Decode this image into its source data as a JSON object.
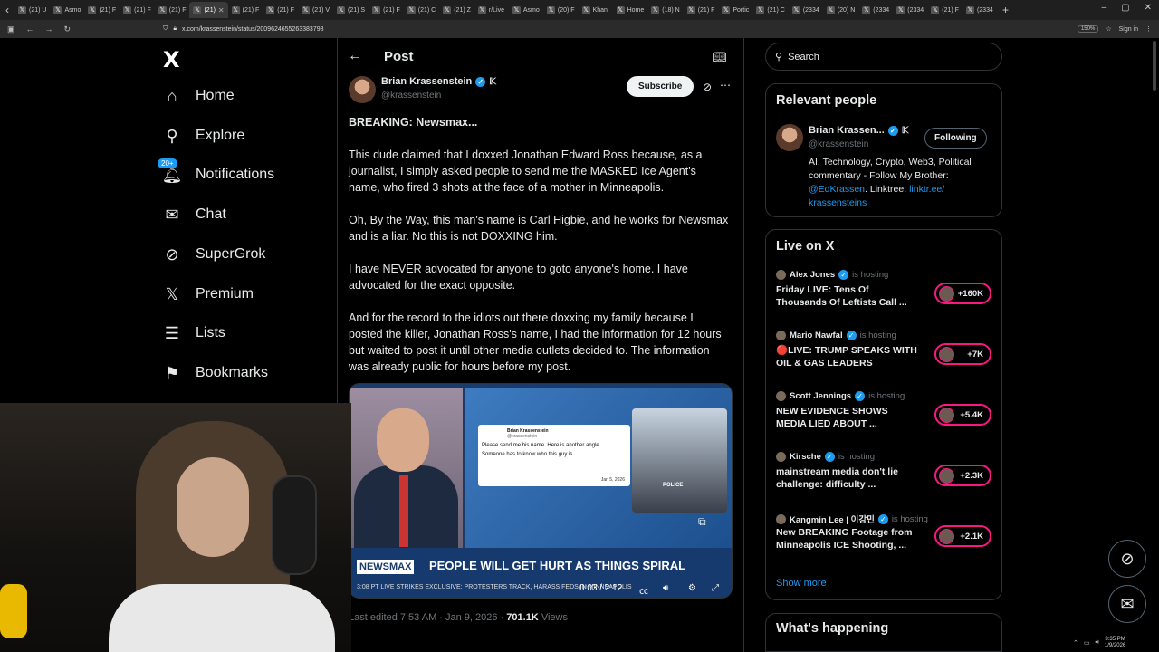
{
  "browser": {
    "tabs": [
      {
        "label": "(21) U",
        "active": false
      },
      {
        "label": "Asmo",
        "active": false
      },
      {
        "label": "(21) F",
        "active": false
      },
      {
        "label": "(21) F",
        "active": false
      },
      {
        "label": "(21) F",
        "active": false
      },
      {
        "label": "(21)",
        "active": true
      },
      {
        "label": "(21) F",
        "active": false
      },
      {
        "label": "(21) F",
        "active": false
      },
      {
        "label": "(21) V",
        "active": false
      },
      {
        "label": "(21) S",
        "active": false
      },
      {
        "label": "(21) F",
        "active": false
      },
      {
        "label": "(21) C",
        "active": false
      },
      {
        "label": "(21) Z",
        "active": false
      },
      {
        "label": "r/Live",
        "active": false
      },
      {
        "label": "Asmo",
        "active": false
      },
      {
        "label": "(20) F",
        "active": false
      },
      {
        "label": "Khan",
        "active": false
      },
      {
        "label": "Home",
        "active": false
      },
      {
        "label": "(18) N",
        "active": false
      },
      {
        "label": "(21) F",
        "active": false
      },
      {
        "label": "Portic",
        "active": false
      },
      {
        "label": "(21) C",
        "active": false
      },
      {
        "label": "(2334",
        "active": false
      },
      {
        "label": "(20) N",
        "active": false
      },
      {
        "label": "(2334",
        "active": false
      },
      {
        "label": "(2334",
        "active": false
      },
      {
        "label": "(21) F",
        "active": false
      },
      {
        "label": "(2334",
        "active": false
      }
    ],
    "url": "x.com/krassenstein/status/2009624655263383798",
    "zoom": "150%",
    "sign_in": "Sign in"
  },
  "nav": {
    "logo": "X",
    "items": [
      {
        "label": "Home",
        "icon": "home-icon",
        "glyph": "⌂"
      },
      {
        "label": "Explore",
        "icon": "search-icon",
        "glyph": "⚲"
      },
      {
        "label": "Notifications",
        "icon": "bell-icon",
        "glyph": "🔔︎",
        "badge": "20+"
      },
      {
        "label": "Chat",
        "icon": "mail-icon",
        "glyph": "✉"
      },
      {
        "label": "SuperGrok",
        "icon": "grok-icon",
        "glyph": "⊘"
      },
      {
        "label": "Premium",
        "icon": "x-premium-icon",
        "glyph": "𝕏"
      },
      {
        "label": "Lists",
        "icon": "lists-icon",
        "glyph": "☰"
      },
      {
        "label": "Bookmarks",
        "icon": "bookmark-icon",
        "glyph": "⚑"
      }
    ]
  },
  "post": {
    "header_title": "Post",
    "author_name": "Brian Krassenstein",
    "author_handle": "@krassenstein",
    "subscribe_label": "Subscribe",
    "paragraphs": [
      "BREAKING:  Newsmax...",
      "This dude claimed that I doxxed Jonathan Edward Ross because, as a journalist, I simply asked people to send me the MASKED Ice Agent's name, who fired 3 shots at the face of a mother in Minneapolis.",
      "Oh, By the Way, this man's name is Carl Higbie, and he works for Newsmax and is a liar. No this is not DOXXING him.",
      "I have NEVER advocated for anyone to goto anyone's home.  I have advocated for the exact opposite.",
      "And for the record to the idiots out there doxxing my family because I posted the killer, Jonathan Ross's name, I had the information for 12 hours but waited to post it until other media outlets decided to.  The information was already public for hours before my post."
    ],
    "video": {
      "card_name": "Brian Krassenstein",
      "card_handle": "@krassenstein",
      "card_text_1": "Please send me his name. Here is another angle.",
      "card_text_2": "Someone has to know who this guy is.",
      "card_date": "Jan 5, 2026",
      "police_label": "POLICE",
      "network": "NEWSMAX",
      "headline": "PEOPLE WILL GET HURT AS THINGS SPIRAL",
      "ticker": "3:08 PT   LIVE   STRIKES    EXCLUSIVE: PROTESTERS TRACK, HARASS FEDS IN MINNEAPOLIS",
      "time": "0:03 / 2:12"
    },
    "meta_prefix": "Last edited 7:53 AM · Jan 9, 2026 · ",
    "views_count": "701.1K",
    "views_label": " Views"
  },
  "sidebar": {
    "search_placeholder": "Search",
    "relevant": {
      "title": "Relevant people",
      "name": "Brian Krassen...",
      "handle": "@krassenstein",
      "following_label": "Following",
      "bio_1": "AI, Technology, Crypto, Web3, Political commentary - Follow My Brother: ",
      "bio_link_1": "@EdKrassen",
      "bio_2": ". Linktree: ",
      "bio_link_2": "linktr.ee/ krassensteins"
    },
    "live": {
      "title": "Live on X",
      "hosting_label": "is hosting",
      "items": [
        {
          "host": "Alex Jones",
          "title": "Friday LIVE: Tens Of Thousands Of Leftists Call ...",
          "count": "+160K"
        },
        {
          "host": "Mario Nawfal",
          "title": "🔴LIVE: TRUMP SPEAKS WITH OIL & GAS LEADERS",
          "count": "+7K"
        },
        {
          "host": "Scott Jennings",
          "title": "NEW EVIDENCE SHOWS MEDIA LIED ABOUT ...",
          "count": "+5.4K"
        },
        {
          "host": "Kirsche",
          "title": "mainstream media don't lie challenge: difficulty ...",
          "count": "+2.3K"
        },
        {
          "host": "Kangmin Lee | 이강민",
          "title": "New BREAKING Footage from Minneapolis ICE Shooting, ...",
          "count": "+2.1K"
        }
      ],
      "show_more": "Show more"
    },
    "whats_happening": "What's happening"
  },
  "taskbar": {
    "time": "3:35 PM",
    "date": "1/9/2026"
  },
  "colors": {
    "accent": "#1d9bf0",
    "live": "#f91880",
    "background": "#000000",
    "border": "#2f3336"
  }
}
